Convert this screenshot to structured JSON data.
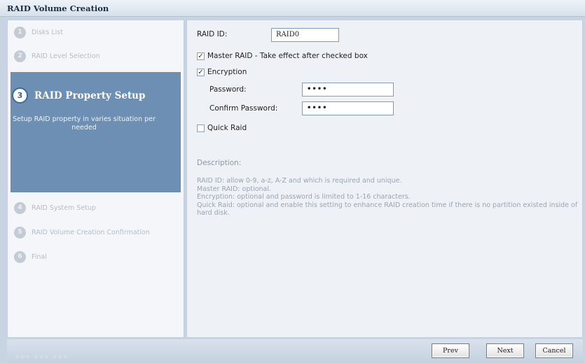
{
  "window": {
    "title": "RAID Volume Creation"
  },
  "steps": [
    {
      "number": "1",
      "label": "Disks List"
    },
    {
      "number": "2",
      "label": "RAID Level Selection"
    },
    {
      "number": "3",
      "label": "RAID Property Setup",
      "description": "Setup RAID property in varies situation per needed"
    },
    {
      "number": "4",
      "label": "RAID System Setup"
    },
    {
      "number": "5",
      "label": "RAID Volume Creation Confirmation"
    },
    {
      "number": "6",
      "label": "Final"
    }
  ],
  "form": {
    "raid_id_label": "RAID ID:",
    "raid_id_value": "RAID0",
    "master_raid_label": "Master RAID - Take effect after checked box",
    "master_raid_checked": true,
    "encryption_label": "Encryption",
    "encryption_checked": true,
    "password_label": "Password:",
    "password_value": "••••",
    "confirm_password_label": "Confirm Password:",
    "confirm_password_value": "••••",
    "quick_raid_label": "Quick Raid",
    "quick_raid_checked": false
  },
  "description": {
    "title": "Description:",
    "lines": [
      "RAID ID: allow 0-9, a-z, A-Z and which is required and unique.",
      "Master RAID: optional.",
      "Encryption: optional and password is limited to 1-16 characters.",
      "Quick Raid: optional and enable this setting to enhance RAID creation time if there is no partition existed inside of hard disk."
    ]
  },
  "buttons": {
    "prev": "Prev",
    "next": "Next",
    "cancel": "Cancel"
  },
  "check_mark": "✓",
  "colors": {
    "active_step_bg": "#6d8fb4",
    "titlebar_bg": "#dde6f0"
  }
}
